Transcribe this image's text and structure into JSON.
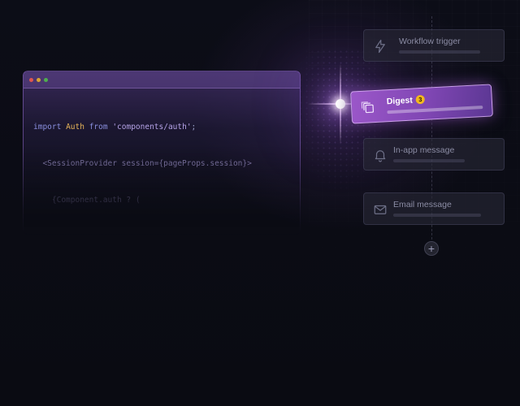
{
  "code_window": {
    "lines": [
      {
        "kw": "import",
        "id": "Auth",
        "kw2": "from",
        "str": "'components/auth'",
        "end": ";"
      },
      {
        "text": "<SessionProvider session={pageProps.session}>"
      },
      {
        "text": "{Component.auth ? ("
      }
    ]
  },
  "workflow": {
    "nodes": [
      {
        "title": "Workflow trigger",
        "icon": "lightning-icon"
      },
      {
        "title": "Digest",
        "icon": "digest-stack-icon",
        "badge": "3",
        "active": true
      },
      {
        "title": "In-app message",
        "icon": "bell-icon"
      },
      {
        "title": "Email message",
        "icon": "envelope-icon"
      }
    ],
    "add_label": "+"
  },
  "colors": {
    "accent": "#9b57c9",
    "badge": "#f3b81e",
    "keyword": "#8b8fe0",
    "identifier": "#e8b45a",
    "string": "#b6a3e8"
  }
}
